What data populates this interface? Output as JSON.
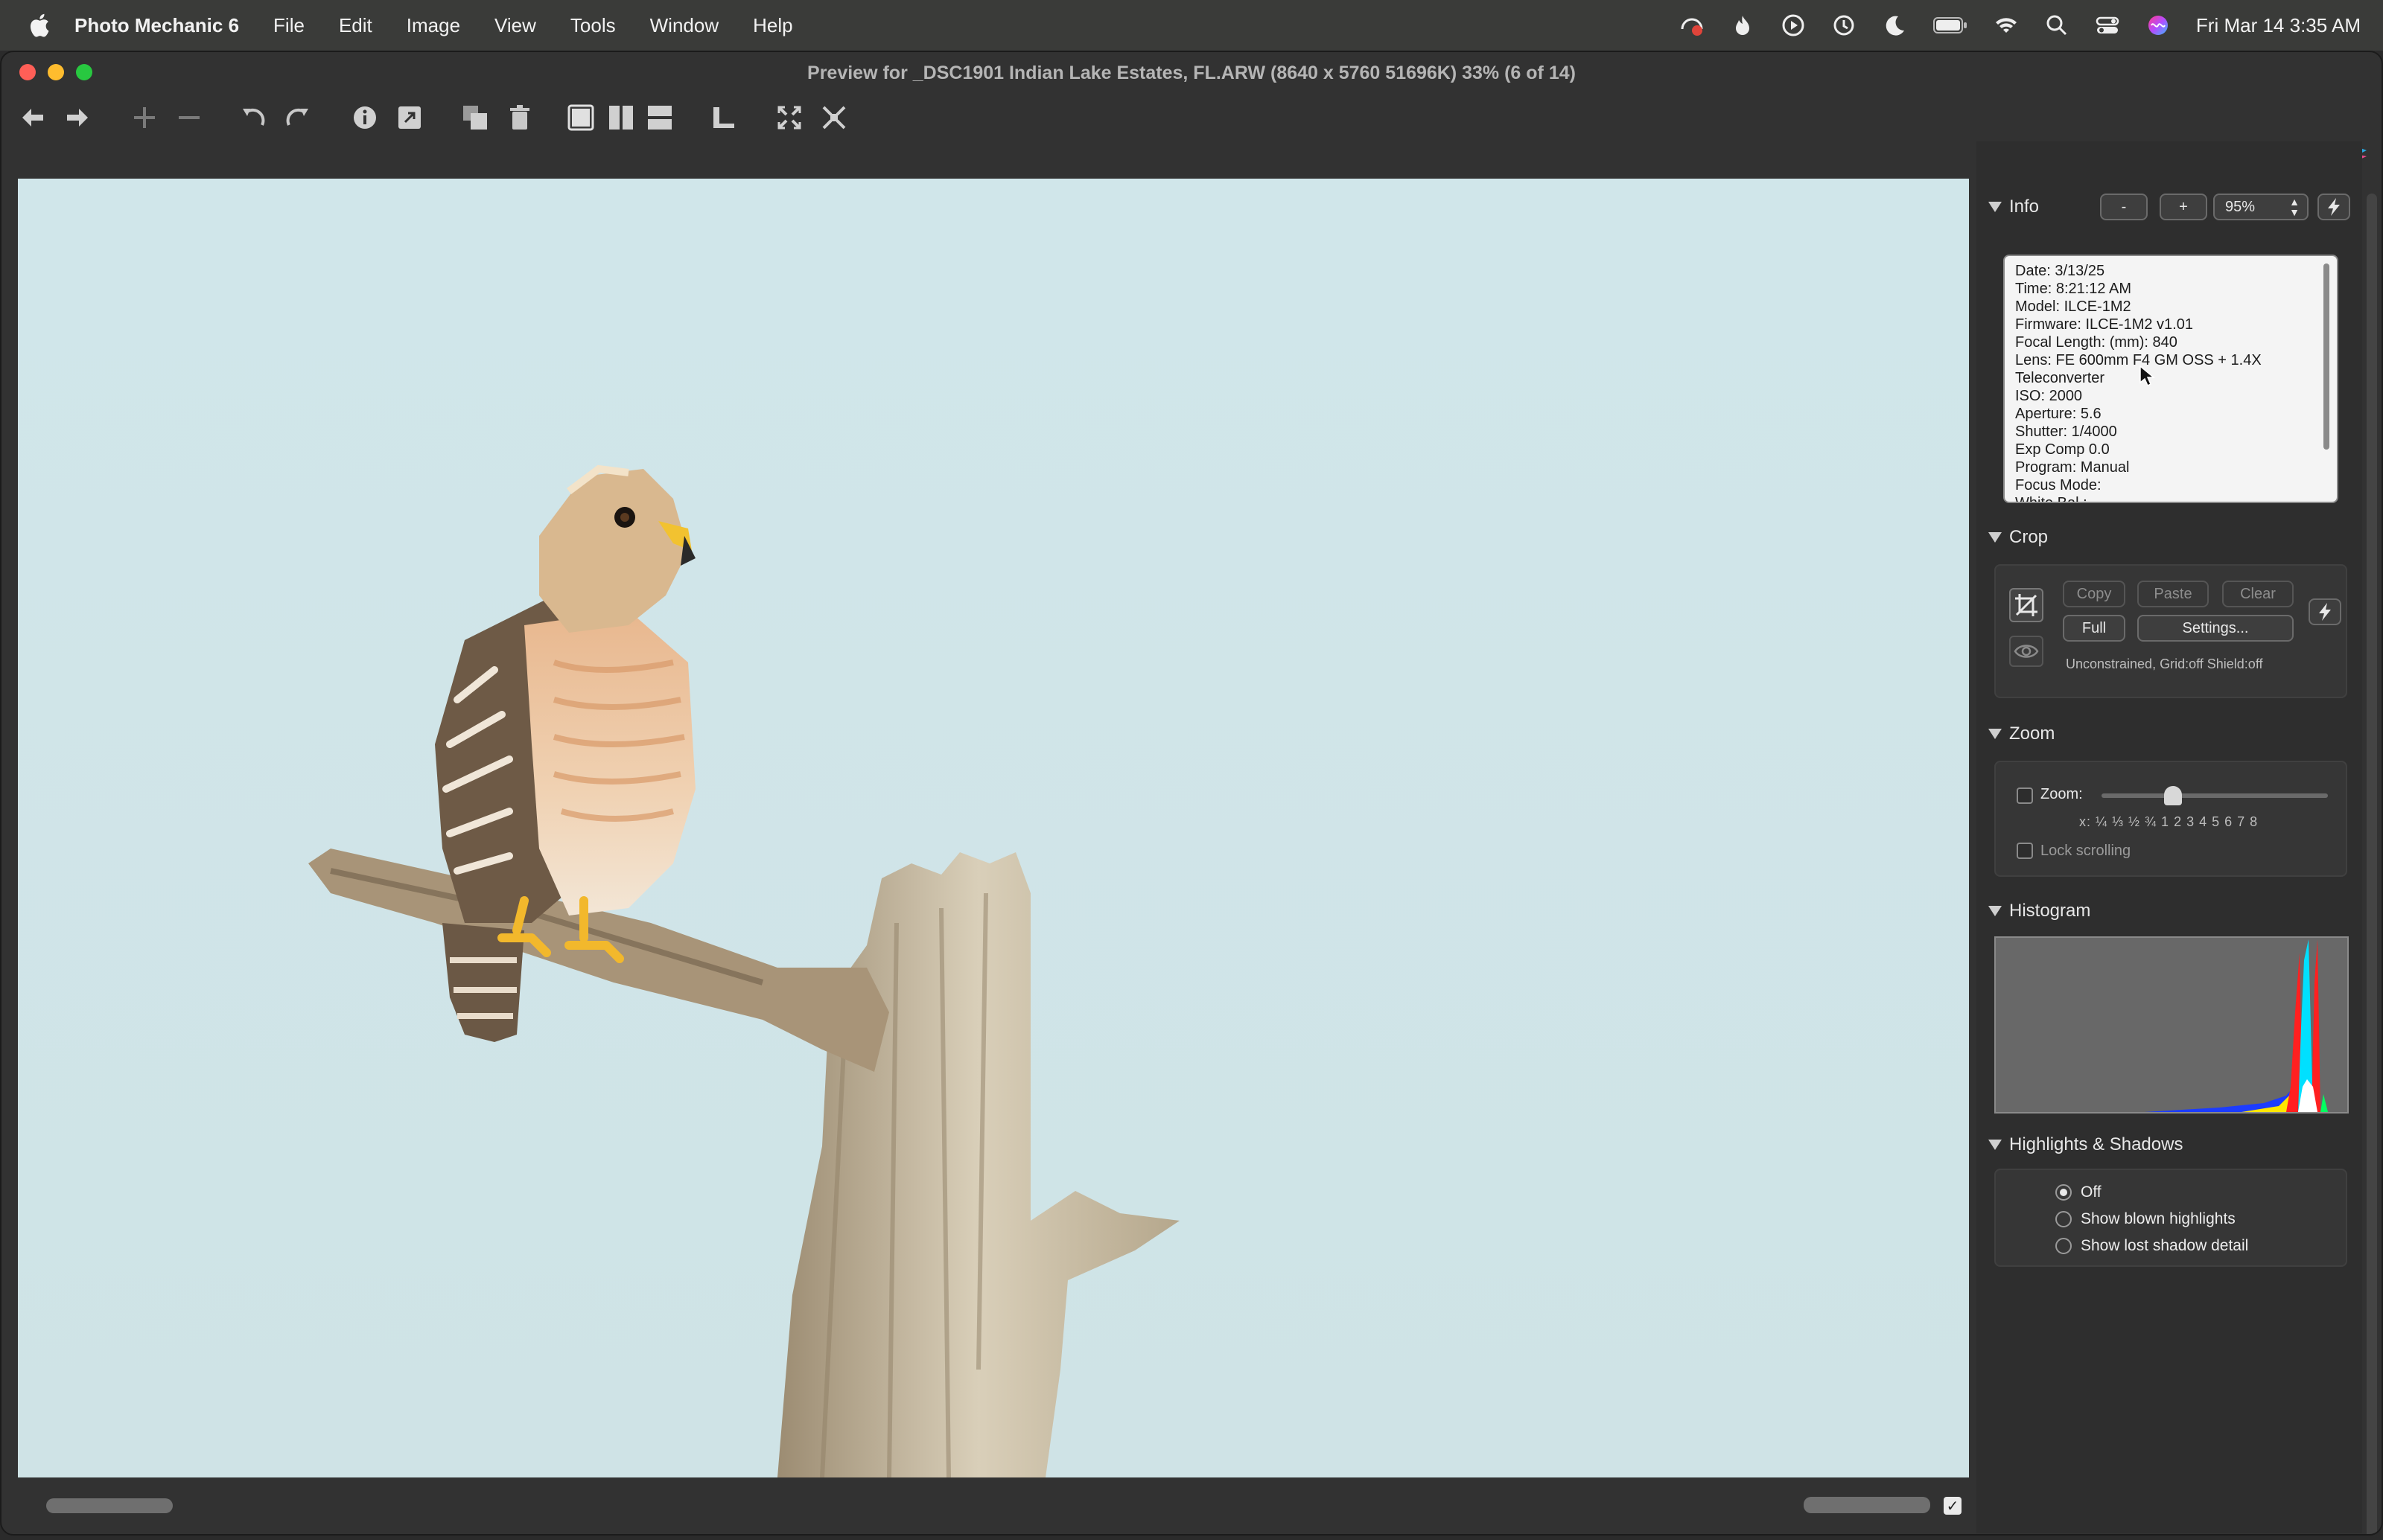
{
  "menubar": {
    "app_name": "Photo Mechanic 6",
    "menus": [
      "File",
      "Edit",
      "Image",
      "View",
      "Tools",
      "Window",
      "Help"
    ],
    "clock": "Fri Mar 14  3:35 AM",
    "status_icons": [
      "screen-record-icon",
      "flame-icon",
      "play-circle-icon",
      "time-machine-icon",
      "moon-icon",
      "battery-icon",
      "wifi-icon",
      "spotlight-search-icon",
      "control-center-icon",
      "siri-icon"
    ]
  },
  "window": {
    "title": "Preview for  _DSC1901 Indian Lake Estates,  FL.ARW (8640 x 5760 51696K) 33% (6 of 14)"
  },
  "toolbar": {
    "icons": [
      "back-arrow-icon",
      "forward-arrow-icon",
      "add-icon",
      "remove-icon",
      "rotate-left-icon",
      "rotate-right-icon",
      "info-icon",
      "export-icon",
      "duplicate-icon",
      "trash-icon",
      "single-view-icon",
      "side-by-side-icon",
      "stacked-view-icon",
      "filmstrip-icon",
      "fit-icon",
      "full-screen-icon"
    ]
  },
  "info": {
    "header": "Info",
    "minus_label": "-",
    "plus_label": "+",
    "zoom_value": "95%",
    "lines": [
      "Date: 3/13/25",
      "Time: 8:21:12 AM",
      "Model: ILCE-1M2",
      "Firmware: ILCE-1M2 v1.01",
      "Focal Length:  (mm): 840",
      "Lens: FE 600mm F4 GM OSS + 1.4X",
      "Teleconverter",
      "ISO: 2000",
      "Aperture: 5.6",
      "Shutter: 1/4000",
      "Exp Comp 0.0",
      "Program: Manual",
      "Focus Mode:",
      "White Bal.:"
    ]
  },
  "crop": {
    "header": "Crop",
    "copy_label": "Copy",
    "paste_label": "Paste",
    "clear_label": "Clear",
    "full_label": "Full",
    "settings_label": "Settings...",
    "status": "Unconstrained, Grid:off Shield:off"
  },
  "zoom": {
    "header": "Zoom",
    "label": "Zoom:",
    "scale": "x:  ¼  ⅓  ½  ¾  1   2   3   4   5   6   7   8",
    "lock_label": "Lock scrolling",
    "slider_value": 0.3
  },
  "histogram": {
    "header": "Histogram"
  },
  "highlights": {
    "header": "Highlights & Shadows",
    "options": [
      "Off",
      "Show blown highlights",
      "Show lost shadow detail"
    ],
    "selected": 0
  },
  "colors": {
    "accent": "#4a90d9",
    "close": "#ff5f57",
    "minimize": "#febc2e",
    "zoom": "#28c840"
  }
}
